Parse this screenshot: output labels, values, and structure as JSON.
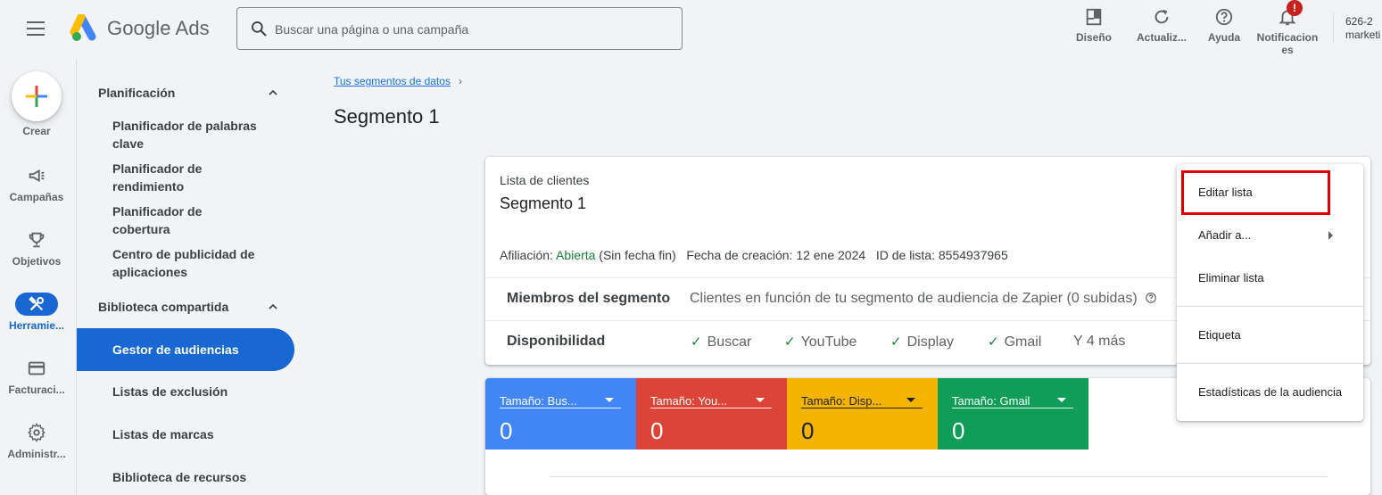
{
  "header": {
    "brand": "Google Ads",
    "search_placeholder": "Buscar una página o una campaña",
    "tools": [
      {
        "label": "Diseño",
        "icon": "layout-icon"
      },
      {
        "label": "Actualiz...",
        "icon": "refresh-icon"
      },
      {
        "label": "Ayuda",
        "icon": "help-icon"
      },
      {
        "label": "Notificacion",
        "label2": "es",
        "icon": "bell-icon",
        "badge": "!"
      }
    ],
    "account_line1": "626-2",
    "account_line2": "marketi"
  },
  "rail": {
    "create_label": "Crear",
    "items": [
      {
        "label": "Campañas",
        "icon": "megaphone-icon"
      },
      {
        "label": "Objetivos",
        "icon": "trophy-icon"
      },
      {
        "label": "Herramie...",
        "icon": "tools-icon"
      },
      {
        "label": "Facturaci...",
        "icon": "credit-card-icon"
      },
      {
        "label": "Administr...",
        "icon": "gear-icon"
      }
    ]
  },
  "nav": {
    "section1": "Planificación",
    "links1": [
      {
        "line1": "Planificador de palabras",
        "line2": "clave"
      },
      {
        "line1": "Planificador de",
        "line2": "rendimiento"
      },
      {
        "line1": "Planificador de",
        "line2": "cobertura"
      },
      {
        "line1": "Centro de publicidad de",
        "line2": "aplicaciones"
      }
    ],
    "section2": "Biblioteca compartida",
    "active": "Gestor de audiencias",
    "links2": [
      "Listas de exclusión",
      "Listas de marcas",
      "Biblioteca de recursos"
    ]
  },
  "main": {
    "breadcrumb": "Tus segmentos de datos",
    "breadcrumb_chevron": "›",
    "title": "Segmento 1",
    "card": {
      "type": "Lista de clientes",
      "name": "Segmento 1",
      "membership_label": "Afiliación:",
      "membership_value": "Abierta",
      "membership_note": "(Sin fecha fin)",
      "created_label": "Fecha de creación:",
      "created_value": "12 ene 2024",
      "list_id_label": "ID de lista:",
      "list_id_value": "8554937965",
      "members_label": "Miembros del segmento",
      "members_text": "Clientes en función de tu segmento de audiencia de Zapier (0 subidas)",
      "availability_label": "Disponibilidad",
      "availability": [
        "Buscar",
        "YouTube",
        "Display",
        "Gmail"
      ],
      "availability_more": "Y 4 más"
    },
    "size_tiles": [
      {
        "label": "Tamaño: Bus...",
        "value": "0",
        "color": "#4285f4"
      },
      {
        "label": "Tamaño: You...",
        "value": "0",
        "color": "#db4437"
      },
      {
        "label": "Tamaño: Disp...",
        "value": "0",
        "color": "#f4b400"
      },
      {
        "label": "Tamaño: Gmail",
        "value": "0",
        "color": "#0f9d58"
      }
    ]
  },
  "menu": {
    "items": [
      "Editar lista",
      "Añadir a...",
      "Eliminar lista",
      "Etiqueta",
      "Estadísticas de la audiencia"
    ]
  },
  "colors": {
    "accent": "#1967d2",
    "highlight": "#e00000",
    "green": "#188038"
  }
}
